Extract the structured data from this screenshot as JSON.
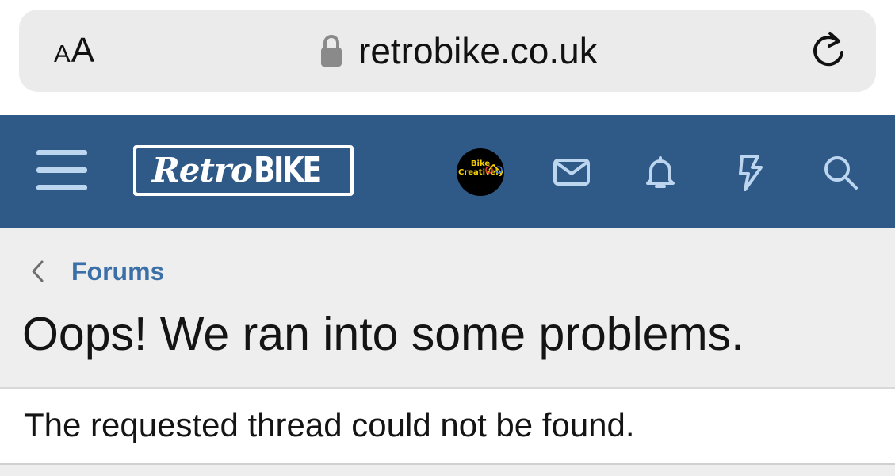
{
  "browser": {
    "text_size_label": "AA",
    "url": "retrobike.co.uk",
    "icons": {
      "lock": "lock-icon",
      "reload": "reload-icon"
    }
  },
  "header": {
    "logo": {
      "part1": "Retro",
      "part2": "BIKE"
    },
    "avatar": {
      "text": "Bike Creatively"
    },
    "icons": [
      "hamburger-menu-icon",
      "envelope-icon",
      "bell-icon",
      "lightning-icon",
      "search-icon"
    ],
    "colors": {
      "background": "#2f5a87",
      "icon": "#bcd6f0"
    }
  },
  "breadcrumb": {
    "label": "Forums"
  },
  "page": {
    "title": "Oops! We ran into some problems.",
    "message": "The requested thread could not be found."
  },
  "colors": {
    "link": "#3a6fa8",
    "content_bg": "#eeeeee"
  }
}
